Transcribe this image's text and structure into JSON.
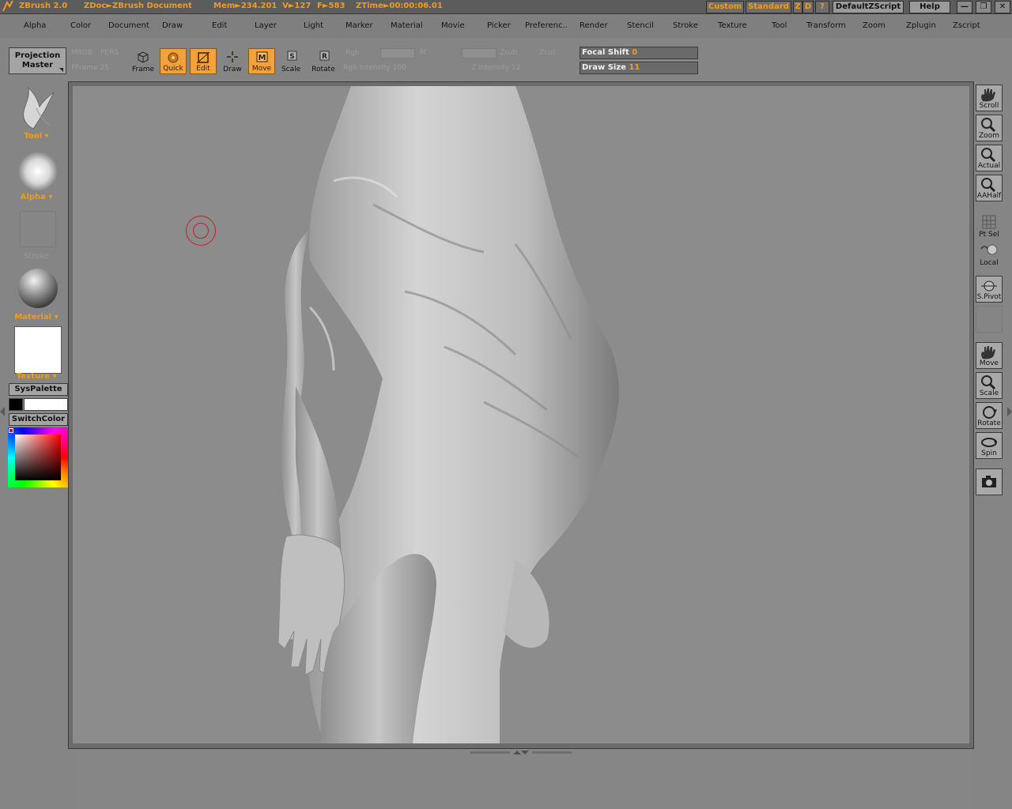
{
  "titlebar": {
    "app": "ZBrush 2.0",
    "doc": "ZDoc►ZBrush Document",
    "mem": "Mem►234.201",
    "verts": "V►127",
    "faces": "F►583",
    "ztime": "ZTime►00:00:06.01",
    "custom": "Custom",
    "standard": "Standard",
    "z": "Z",
    "d": "D",
    "q": "?",
    "script": "DefaultZScript",
    "help": "Help"
  },
  "menu": [
    "Alpha",
    "Color",
    "Document",
    "Draw",
    "Edit",
    "Layer",
    "Light",
    "Marker",
    "Material",
    "Movie",
    "Picker",
    "Preferenc..",
    "Render",
    "Stencil",
    "Stroke",
    "Texture",
    "Tool",
    "Transform",
    "Zoom",
    "Zplugin",
    "Zscript"
  ],
  "shelf": {
    "projection_master": "Projection Master",
    "tools": [
      {
        "label": "Frame"
      },
      {
        "label": "Quick"
      },
      {
        "label": "Edit"
      },
      {
        "label": "Draw"
      },
      {
        "label": "Move"
      },
      {
        "label": "Scale"
      },
      {
        "label": "Rotate"
      }
    ],
    "dim_labels": {
      "mrgb": "MRGB",
      "pers": "PERS",
      "pframe": "PFrame 25",
      "rgb": "Rgb",
      "m": "M",
      "zsub": "Zsub",
      "zcut": "Zcut",
      "rgb_intensity": "Rgb Intensity 100",
      "z_intensity": "Z Intensity 12"
    },
    "focal_shift_label": "Focal Shift",
    "focal_shift_value": "0",
    "draw_size_label": "Draw Size",
    "draw_size_value": "11"
  },
  "left": {
    "tool": "Tool",
    "alpha": "Alpha",
    "stroke": "Stroke",
    "material": "Material",
    "texture": "Texture",
    "syspalette": "SysPalette",
    "switchcolor": "SwitchColor"
  },
  "right": [
    {
      "label": "Scroll"
    },
    {
      "label": "Zoom"
    },
    {
      "label": "Actual"
    },
    {
      "label": "AAHalf"
    },
    {
      "label": "Pt Sel"
    },
    {
      "label": "Local"
    },
    {
      "label": "S.Pivot"
    },
    {
      "label": "Move"
    },
    {
      "label": "Scale"
    },
    {
      "label": "Rotate"
    },
    {
      "label": "Spin"
    }
  ],
  "colors": {
    "accent": "#f29a1a",
    "canvas": "#8c8c8c",
    "panel": "#858585"
  }
}
